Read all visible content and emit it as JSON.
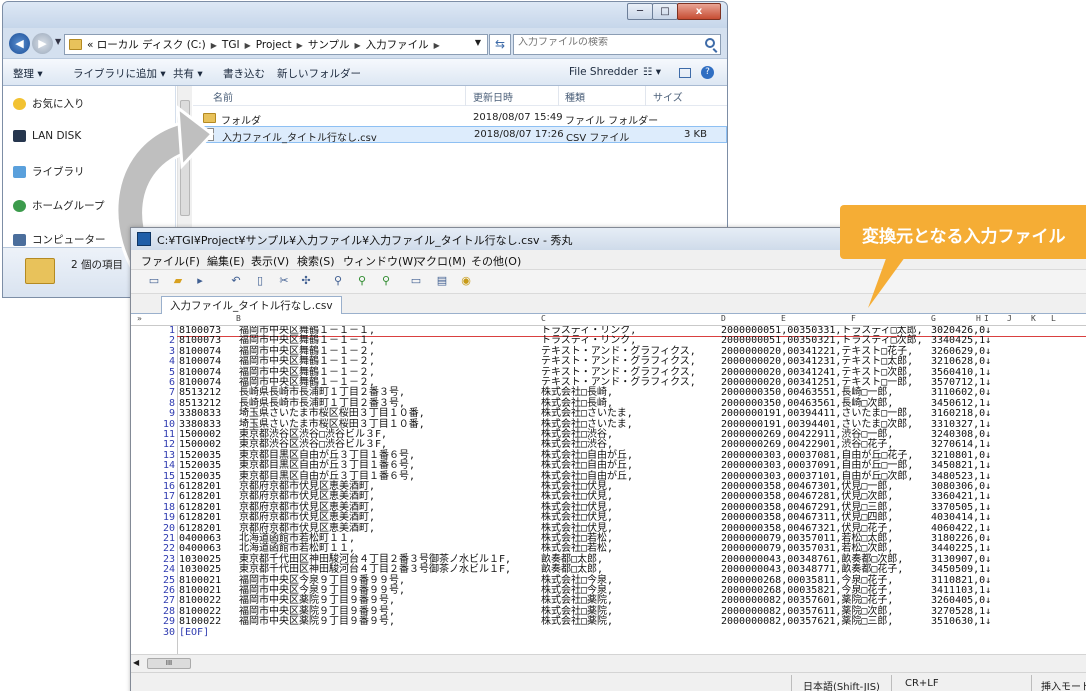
{
  "explorer": {
    "caption_buttons": {
      "minimize": "─",
      "maximize": "□",
      "close": "x"
    },
    "address_path": [
      "«  ローカル ディスク (C:)",
      "TGI",
      "Project",
      "サンプル",
      "入力ファイル"
    ],
    "search_placeholder": "入力ファイルの検索",
    "toolbar": {
      "organize": "整理 ▾",
      "add_to_library": "ライブラリに追加 ▾",
      "share": "共有 ▾",
      "burn": "書き込む",
      "new_folder": "新しいフォルダー",
      "file_shredder": "File Shredder",
      "view": "☷ ▾"
    },
    "nav_items": [
      {
        "label": "お気に入り",
        "icon": "star-icon"
      },
      {
        "label": "LAN DISK",
        "icon": "lan-disk-icon"
      },
      {
        "label": "ライブラリ",
        "icon": "library-icon"
      },
      {
        "label": "ホームグループ",
        "icon": "homegroup-icon"
      },
      {
        "label": "コンピューター",
        "icon": "computer-icon"
      }
    ],
    "columns": {
      "name": "名前",
      "modified": "更新日時",
      "type": "種類",
      "size": "サイズ"
    },
    "files": [
      {
        "name": "フォルダ",
        "modified": "2018/08/07 15:49",
        "type": "ファイル フォルダー",
        "size": "",
        "icon": "folder-icon"
      },
      {
        "name": "入力ファイル_タイトル行なし.csv",
        "modified": "2018/08/07 17:26",
        "type": "CSV ファイル",
        "size": "3 KB",
        "icon": "csv-file-icon"
      }
    ],
    "status_count": "2 個の項目"
  },
  "editor": {
    "title": "C:¥TGI¥Project¥サンプル¥入力ファイル¥入力ファイル_タイトル行なし.csv - 秀丸",
    "menu": [
      "ファイル(F)",
      "編集(E)",
      "表示(V)",
      "検索(S)",
      "ウィンドウ(W)",
      "マクロ(M)",
      "その他(O)"
    ],
    "tab_label": "入力ファイル_タイトル行なし.csv",
    "ruler_cols": [
      "A",
      "B",
      "C",
      "D",
      "E",
      "F",
      "G",
      "H",
      "I",
      "J",
      "K",
      "L"
    ],
    "lines": [
      [
        "1",
        "8100073",
        "福岡市中央区舞鶴１－１－１,",
        "トラスティ・リンク,",
        "2000000051,00350331,トラスティ□太郎,",
        "3020426,0↓"
      ],
      [
        "2",
        "8100073",
        "福岡市中央区舞鶴１－１－１,",
        "トラスティ・リンク,",
        "2000000051,00350321,トラスティ□次郎,",
        "3340425,1↓"
      ],
      [
        "3",
        "8100074",
        "福岡市中央区舞鶴１－１－２,",
        "テキスト・アンド・グラフィクス,",
        "2000000020,00341221,テキスト□花子,",
        "3260629,0↓"
      ],
      [
        "4",
        "8100074",
        "福岡市中央区舞鶴１－１－２,",
        "テキスト・アンド・グラフィクス,",
        "2000000020,00341231,テキスト□太郎,",
        "3210628,0↓"
      ],
      [
        "5",
        "8100074",
        "福岡市中央区舞鶴１－１－２,",
        "テキスト・アンド・グラフィクス,",
        "2000000020,00341241,テキスト□次郎,",
        "3560410,1↓"
      ],
      [
        "6",
        "8100074",
        "福岡市中央区舞鶴１－１－２,",
        "テキスト・アンド・グラフィクス,",
        "2000000020,00341251,テキスト□一郎,",
        "3570712,1↓"
      ],
      [
        "7",
        "8513212",
        "長崎県長崎市長浦町１丁目２番３号,",
        "株式会社□長崎,",
        "2000000350,00463551,長崎□一郎,",
        "3110602,0↓"
      ],
      [
        "8",
        "8513212",
        "長崎県長崎市長浦町１丁目２番３号,",
        "株式会社□長崎,",
        "2000000350,00463561,長崎□次郎,",
        "3450612,1↓"
      ],
      [
        "9",
        "3380833",
        "埼玉県さいたま市桜区桜田３丁目１０番,",
        "株式会社□さいたま,",
        "2000000191,00394411,さいたま□一郎,",
        "3160218,0↓"
      ],
      [
        "10",
        "3380833",
        "埼玉県さいたま市桜区桜田３丁目１０番,",
        "株式会社□さいたま,",
        "2000000191,00394401,さいたま□次郎,",
        "3310327,1↓"
      ],
      [
        "11",
        "1500002",
        "東京都渋谷区渋谷□渋谷ビル３F,",
        "株式会社□渋谷,",
        "2000000269,00422911,渋谷□一郎,",
        "3240308,0↓"
      ],
      [
        "12",
        "1500002",
        "東京都渋谷区渋谷□渋谷ビル３F,",
        "株式会社□渋谷,",
        "2000000269,00422901,渋谷□花子,",
        "3270614,1↓"
      ],
      [
        "13",
        "1520035",
        "東京都目黒区自由が丘３丁目１番６号,",
        "株式会社□自由が丘,",
        "2000000303,00037081,自由が丘□花子,",
        "3210801,0↓"
      ],
      [
        "14",
        "1520035",
        "東京都目黒区自由が丘３丁目１番６号,",
        "株式会社□自由が丘,",
        "2000000303,00037091,自由が丘□一郎,",
        "3450821,1↓"
      ],
      [
        "15",
        "1520035",
        "東京都目黒区自由が丘３丁目１番６号,",
        "株式会社□自由が丘,",
        "2000000303,00037101,自由が丘□次郎,",
        "3480523,1↓"
      ],
      [
        "16",
        "6128201",
        "京都府京都市伏見区恵美酒町,",
        "株式会社□伏見,",
        "2000000358,00467301,伏見□一郎,",
        "3080306,0↓"
      ],
      [
        "17",
        "6128201",
        "京都府京都市伏見区恵美酒町,",
        "株式会社□伏見,",
        "2000000358,00467281,伏見□次郎,",
        "3360421,1↓"
      ],
      [
        "18",
        "6128201",
        "京都府京都市伏見区恵美酒町,",
        "株式会社□伏見,",
        "2000000358,00467291,伏見□三郎,",
        "3370505,1↓"
      ],
      [
        "19",
        "6128201",
        "京都府京都市伏見区恵美酒町,",
        "株式会社□伏見,",
        "2000000358,00467311,伏見□四郎,",
        "4030414,1↓"
      ],
      [
        "20",
        "6128201",
        "京都府京都市伏見区恵美酒町,",
        "株式会社□伏見,",
        "2000000358,00467321,伏見□花子,",
        "4060422,1↓"
      ],
      [
        "21",
        "0400063",
        "北海道函館市若松町１１,",
        "株式会社□若松,",
        "2000000079,00357011,若松□太郎,",
        "3180226,0↓"
      ],
      [
        "22",
        "0400063",
        "北海道函館市若松町１１,",
        "株式会社□若松,",
        "2000000079,00357031,若松□次郎,",
        "3440225,1↓"
      ],
      [
        "23",
        "1030025",
        "東京都千代田区神田駿河台４丁目２番３号御茶ノ水ビル１F,",
        "畝奏都□太郎,",
        "2000000043,00348761,畝奏都□次郎,",
        "3130907,0↓"
      ],
      [
        "24",
        "1030025",
        "東京都千代田区神田駿河台４丁目２番３号御茶ノ水ビル１F,",
        "畝奏都□太郎,",
        "2000000043,00348771,畝奏都□花子,",
        "3450509,1↓"
      ],
      [
        "25",
        "8100021",
        "福岡市中央区今泉９丁目９番９９号,",
        "株式会社□今泉,",
        "2000000268,00035811,今泉□花子,",
        "3110821,0↓"
      ],
      [
        "26",
        "8100021",
        "福岡市中央区今泉９丁目９番９９号,",
        "株式会社□今泉,",
        "2000000268,00035821,今泉□花子,",
        "3411103,1↓"
      ],
      [
        "27",
        "8100022",
        "福岡市中央区薬院９丁目９番９号,",
        "株式会社□薬院,",
        "2000000082,00357601,薬院□花子,",
        "3260405,0↓"
      ],
      [
        "28",
        "8100022",
        "福岡市中央区薬院９丁目９番９号,",
        "株式会社□薬院,",
        "2000000082,00357611,薬院□次郎,",
        "3270528,1↓"
      ],
      [
        "29",
        "8100022",
        "福岡市中央区薬院９丁目９番９号,",
        "株式会社□薬院,",
        "2000000082,00357621,薬院□三郎,",
        "3510630,1↓"
      ]
    ],
    "eof_line": {
      "num": "30",
      "text": "[EOF]"
    },
    "status": {
      "encoding": "日本語(Shift-JIS)",
      "newline": "CR+LF",
      "mode": "挿入モード"
    }
  },
  "callout_text": "変換元となる入力ファイル",
  "colors": {
    "callout": "#f5ad35",
    "line_number": "#2f3bb0",
    "cursor_line": "#d94040"
  }
}
